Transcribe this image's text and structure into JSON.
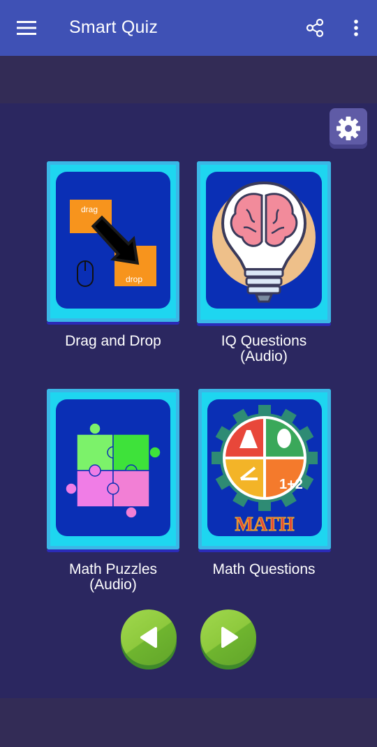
{
  "appbar": {
    "title": "Smart Quiz",
    "color": "#3f51b5",
    "icons": [
      "menu-icon",
      "share-icon",
      "more-vert-icon"
    ]
  },
  "settings": {
    "icon": "gear-icon"
  },
  "tiles": [
    {
      "label": "Drag and Drop",
      "image": "drag-and-drop",
      "drag_text": "drag",
      "drop_text": "drop"
    },
    {
      "label": "IQ Questions\n(Audio)",
      "image": "brain-lightbulb"
    },
    {
      "label": "Math Puzzles\n(Audio)",
      "image": "jigsaw-puzzle"
    },
    {
      "label": "Math Questions",
      "image": "math-gear",
      "badge_text": "MATH",
      "sum_text": "1+2"
    }
  ],
  "navigation": {
    "prev_icon": "triangle-left-icon",
    "next_icon": "triangle-right-icon"
  },
  "colors": {
    "background": "#2b2760",
    "tile_frame": "#1ed6f0",
    "tile_inner": "#0a2fb5",
    "nav_button": "#8ec93d"
  }
}
